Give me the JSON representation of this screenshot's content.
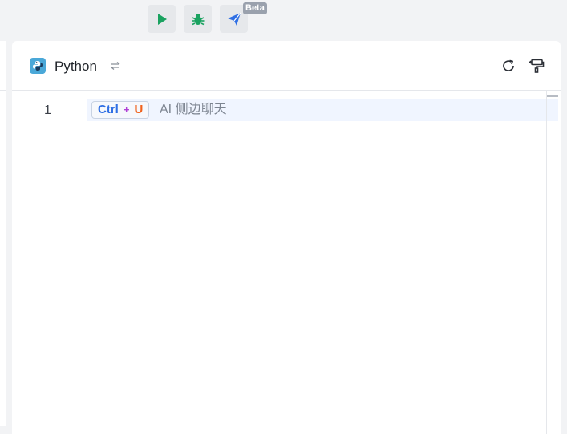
{
  "toolbar": {
    "buttons": [
      {
        "name": "run",
        "icon": "play-icon",
        "color": "#1aa260"
      },
      {
        "name": "debug",
        "icon": "bug-icon",
        "color": "#1aa260"
      },
      {
        "name": "send",
        "icon": "send-icon",
        "color": "#2f6fe4"
      }
    ],
    "beta_label": "Beta"
  },
  "panel": {
    "language": "Python",
    "language_icon": "python-icon",
    "switch_icon": "swap-icon",
    "actions": [
      {
        "name": "refresh",
        "icon": "refresh-icon"
      },
      {
        "name": "format",
        "icon": "format-paint-icon"
      }
    ]
  },
  "editor": {
    "lines": [
      {
        "number": "1"
      }
    ],
    "shortcut": {
      "ctrl": "Ctrl",
      "plus": "+",
      "key": "U"
    },
    "hint": "AI 侧边聊天"
  },
  "colors": {
    "accent": "#2f6fe4",
    "success": "#1aa260",
    "shortcut_ctrl": "#2f6fe4",
    "shortcut_plus": "#b03fd6",
    "shortcut_key": "#f0621c"
  }
}
